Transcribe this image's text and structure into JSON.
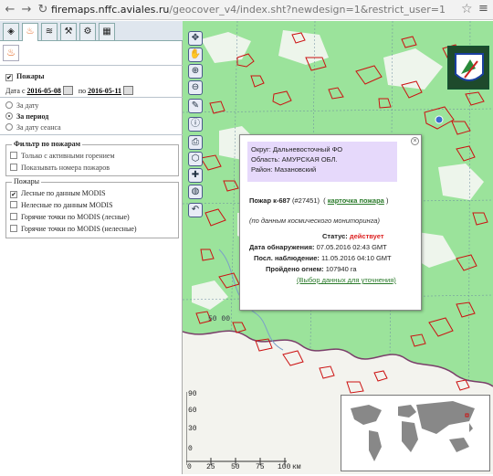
{
  "browser": {
    "url_host": "firemaps.nffc.aviales.ru",
    "url_path": "/geocover_v4/index.sht?newdesign=1&restrict_user=1"
  },
  "left_panel": {
    "fires_label": "Пожары",
    "date_from_label": "Дата с",
    "date_from": "2016-05-08",
    "date_to_label": "по",
    "date_to": "2016-05-11",
    "options": [
      "За дату",
      "За период",
      "За дату сеанса"
    ],
    "selected_option": "За период",
    "filter_title": "Фильтр по пожарам",
    "filter_items": [
      "Только с активными горением",
      "Показывать номера пожаров"
    ],
    "fires_group_title": "Пожары",
    "fires_group_items": [
      {
        "label": "Лесные по данным MODIS",
        "checked": true
      },
      {
        "label": "Нелесные по данным MODIS",
        "checked": false
      },
      {
        "label": "Горячие точки по MODIS (лесные)",
        "checked": false
      },
      {
        "label": "Горячие точки по MODIS (нелесные)",
        "checked": false
      }
    ]
  },
  "popup": {
    "district": "Округ: Дальневосточный ФО",
    "region": "Область: АМУРСКАЯ ОБЛ.",
    "area": "Район: Мазановский",
    "fire_title": "Пожар к-687",
    "fire_id": "(#27451)",
    "fire_card_link": "карточка пожара",
    "source_note": "(по данным космического мониторинга)",
    "status_label": "Статус:",
    "status_value": "действует",
    "detected_label": "Дата обнаружения:",
    "detected_value": "07.05.2016 02:43 GMT",
    "observed_label": "Посл. наблюдение:",
    "observed_value": "11.05.2016 04:10 GMT",
    "burned_label": "Пройдено огнем:",
    "burned_value": "107940 га",
    "select_link": "(Выбор данных для уточнения)"
  },
  "map": {
    "lat_label": "50 00",
    "scale_ticks": [
      "0",
      "25",
      "50",
      "75",
      "100"
    ],
    "scale_unit": "км",
    "scale_left_ticks": [
      "90",
      "60",
      "30",
      "0"
    ],
    "fire_color": "#cc1111",
    "land_color": "#9be39b",
    "forest_color": "#f4f4f4",
    "border_color": "#7a3f6a"
  }
}
